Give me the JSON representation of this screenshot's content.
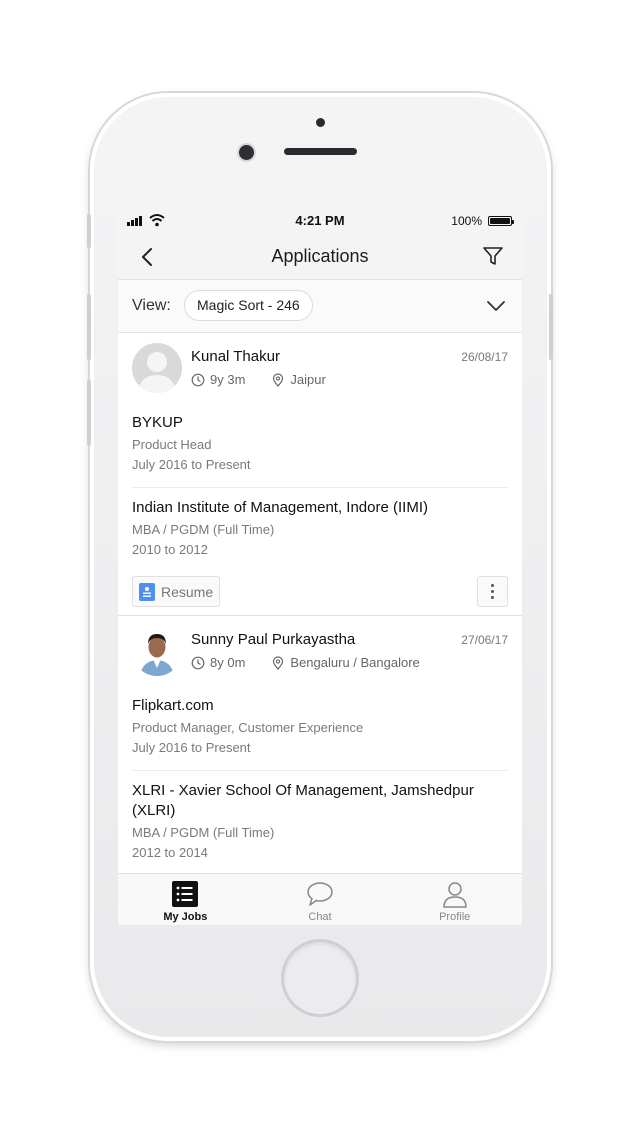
{
  "status_bar": {
    "time": "4:21 PM",
    "battery": "100%",
    "battery_level": 1.0
  },
  "header": {
    "title": "Applications"
  },
  "view_bar": {
    "label": "View:",
    "sort_chip": "Magic Sort - 246"
  },
  "applicants": [
    {
      "name": "Kunal Thakur",
      "date": "26/08/17",
      "experience": "9y 3m",
      "location": "Jaipur",
      "job": {
        "company": "BYKUP",
        "title": "Product Head",
        "period": "July 2016 to Present"
      },
      "education": {
        "school": "Indian Institute of Management, Indore (IIMI)",
        "degree": "MBA / PGDM (Full Time)",
        "period": "2010 to 2012"
      },
      "resume_label": "Resume"
    },
    {
      "name": "Sunny Paul Purkayastha",
      "date": "27/06/17",
      "experience": "8y 0m",
      "location": "Bengaluru / Bangalore",
      "job": {
        "company": "Flipkart.com",
        "title": "Product Manager, Customer Experience",
        "period": "July 2016 to Present"
      },
      "education": {
        "school": "XLRI - Xavier School Of Management, Jamshedpur (XLRI)",
        "degree": "MBA / PGDM (Full Time)",
        "period": "2012 to 2014"
      }
    }
  ],
  "tabs": [
    {
      "label": "My Jobs",
      "icon": "list-icon",
      "active": true
    },
    {
      "label": "Chat",
      "icon": "chat-bubble-icon",
      "active": false
    },
    {
      "label": "Profile",
      "icon": "person-icon",
      "active": false
    }
  ],
  "colors": {
    "accent": "#4e8ff0",
    "text": "#111111",
    "muted": "#7a7a7a"
  }
}
